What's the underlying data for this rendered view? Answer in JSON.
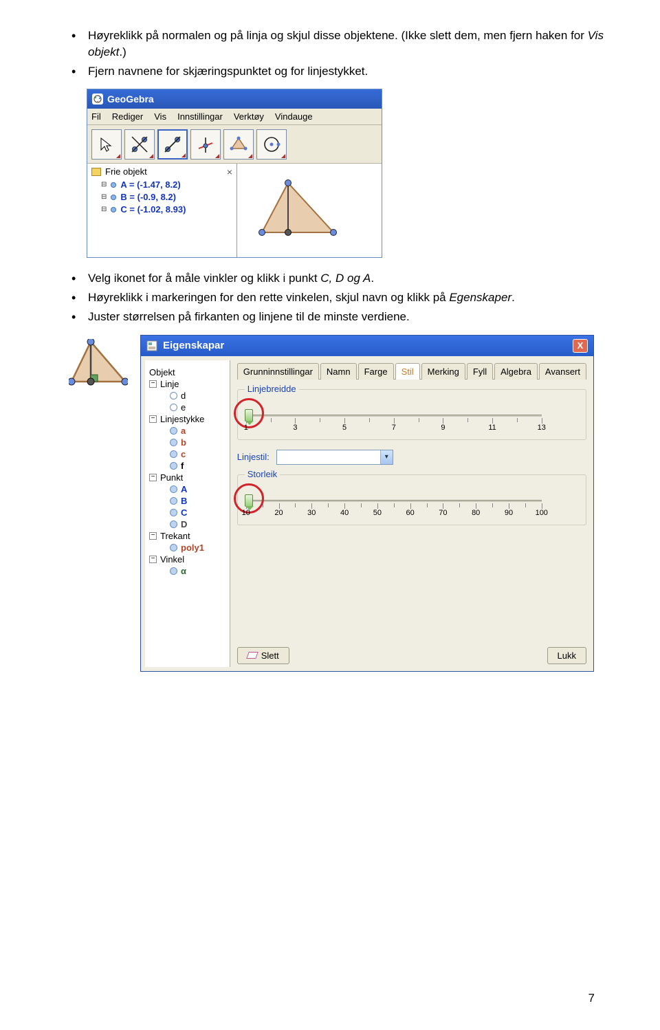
{
  "bullets_top": [
    {
      "pre": "Høyreklikk på normalen og på linja og skjul disse objektene. (Ikke slett dem, men fjern haken for ",
      "italic": "Vis objekt",
      "post": ".)"
    },
    {
      "pre": "Fjern navnene for skjæringspunktet og for linjestykket.",
      "italic": "",
      "post": ""
    }
  ],
  "bullets_mid": [
    {
      "pre": "Velg ikonet for å måle vinkler og klikk i punkt ",
      "italic": "C, D og A",
      "post": "."
    },
    {
      "pre": "Høyreklikk i markeringen for den rette vinkelen, skjul navn og klikk på ",
      "italic": "Egenskaper",
      "post": "."
    },
    {
      "pre": "Juster størrelsen på firkanten og linjene til de minste verdiene.",
      "italic": "",
      "post": ""
    }
  ],
  "geogebra": {
    "title": "GeoGebra",
    "menu": [
      "Fil",
      "Rediger",
      "Vis",
      "Innstillingar",
      "Verktøy",
      "Vindauge"
    ],
    "panel_header": "Frie objekt",
    "items": [
      {
        "name": "A",
        "val": "(-1.47, 8.2)"
      },
      {
        "name": "B",
        "val": "(-0.9, 8.2)"
      },
      {
        "name": "C",
        "val": "(-1.02, 8.93)"
      }
    ]
  },
  "dialog": {
    "title": "Eigenskapar",
    "tree_root": "Objekt",
    "tree": [
      {
        "type": "grp",
        "label": "Linje",
        "open": true
      },
      {
        "type": "sub",
        "label": "d",
        "ball": "empty",
        "bold": false
      },
      {
        "type": "sub",
        "label": "e",
        "ball": "empty",
        "bold": false
      },
      {
        "type": "grp",
        "label": "Linjestykke",
        "open": true
      },
      {
        "type": "sub",
        "label": "a",
        "ball": "fill",
        "bold": true,
        "color": "#b04427"
      },
      {
        "type": "sub",
        "label": "b",
        "ball": "fill",
        "bold": true,
        "color": "#b04427"
      },
      {
        "type": "sub",
        "label": "c",
        "ball": "fill",
        "bold": true,
        "color": "#b04427"
      },
      {
        "type": "sub",
        "label": "f",
        "ball": "fill",
        "bold": true,
        "color": "#000"
      },
      {
        "type": "grp",
        "label": "Punkt",
        "open": true
      },
      {
        "type": "sub",
        "label": "A",
        "ball": "fill",
        "bold": true,
        "color": "#1234bc"
      },
      {
        "type": "sub",
        "label": "B",
        "ball": "fill",
        "bold": true,
        "color": "#1234bc"
      },
      {
        "type": "sub",
        "label": "C",
        "ball": "fill",
        "bold": true,
        "color": "#1234bc"
      },
      {
        "type": "sub",
        "label": "D",
        "ball": "fill",
        "bold": true,
        "color": "#444"
      },
      {
        "type": "grp",
        "label": "Trekant",
        "open": true
      },
      {
        "type": "sub",
        "label": "poly1",
        "ball": "fill",
        "bold": true,
        "color": "#b04427"
      },
      {
        "type": "grp",
        "label": "Vinkel",
        "open": true
      },
      {
        "type": "sub",
        "label": "α",
        "ball": "fill",
        "bold": true,
        "color": "#2a6a2f"
      }
    ],
    "tabs": [
      "Grunninnstillingar",
      "Namn",
      "Farge",
      "Stil",
      "Merking",
      "Fyll",
      "Algebra",
      "Avansert"
    ],
    "tab_selected": "Stil",
    "group1_label": "Linjebreidde",
    "slider1_ticks": [
      "1",
      "3",
      "5",
      "7",
      "9",
      "11",
      "13"
    ],
    "linestyle_label": "Linjestil:",
    "group2_label": "Storleik",
    "slider2_ticks": [
      "10",
      "20",
      "30",
      "40",
      "50",
      "60",
      "70",
      "80",
      "90",
      "100"
    ],
    "btn_delete": "Slett",
    "btn_close": "Lukk"
  },
  "page_number": "7"
}
